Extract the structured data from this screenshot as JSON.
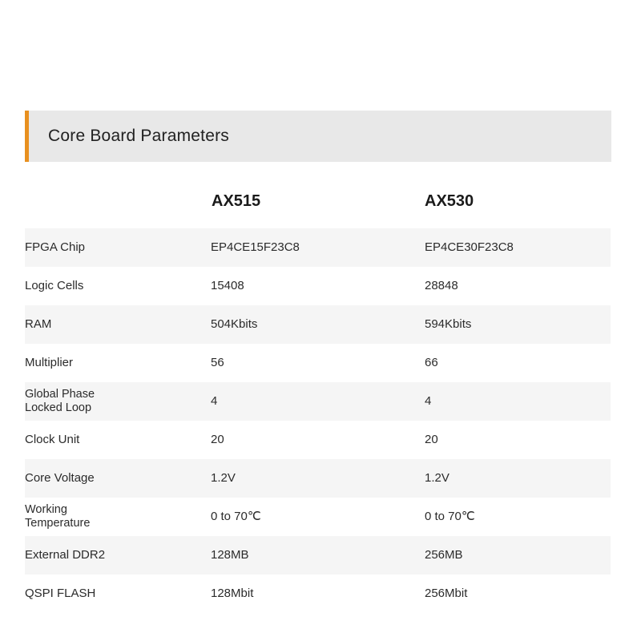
{
  "section": {
    "title": "Core Board Parameters",
    "accent_color": "#e8901f",
    "header_bg": "#e8e8e8"
  },
  "table": {
    "columns": [
      {
        "key": "parameter",
        "label": ""
      },
      {
        "key": "ax515",
        "label": "AX515"
      },
      {
        "key": "ax530",
        "label": "AX530"
      }
    ],
    "rows": [
      {
        "label": "FPGA Chip",
        "label_line1": "FPGA Chip",
        "label_line2": "",
        "ax515": "EP4CE15F23C8",
        "ax530": "EP4CE30F23C8"
      },
      {
        "label": "Logic Cells",
        "label_line1": "Logic Cells",
        "label_line2": "",
        "ax515": "15408",
        "ax530": "28848"
      },
      {
        "label": "RAM",
        "label_line1": "RAM",
        "label_line2": "",
        "ax515": "504Kbits",
        "ax530": "594Kbits"
      },
      {
        "label": "Multiplier",
        "label_line1": "Multiplier",
        "label_line2": "",
        "ax515": "56",
        "ax530": "66"
      },
      {
        "label": "Global Phase Locked Loop",
        "label_line1": "Global Phase",
        "label_line2": "Locked Loop",
        "ax515": "4",
        "ax530": "4"
      },
      {
        "label": "Clock Unit",
        "label_line1": "Clock Unit",
        "label_line2": "",
        "ax515": "20",
        "ax530": "20"
      },
      {
        "label": "Core Voltage",
        "label_line1": "Core Voltage",
        "label_line2": "",
        "ax515": "1.2V",
        "ax530": "1.2V"
      },
      {
        "label": "Working Temperature",
        "label_line1": "Working",
        "label_line2": "Temperature",
        "ax515": "0 to 70℃",
        "ax530": "0 to 70℃"
      },
      {
        "label": "External DDR2",
        "label_line1": "External DDR2",
        "label_line2": "",
        "ax515": "128MB",
        "ax530": "256MB"
      },
      {
        "label": "QSPI FLASH",
        "label_line1": "QSPI FLASH",
        "label_line2": "",
        "ax515": "128Mbit",
        "ax530": "256Mbit"
      }
    ]
  }
}
